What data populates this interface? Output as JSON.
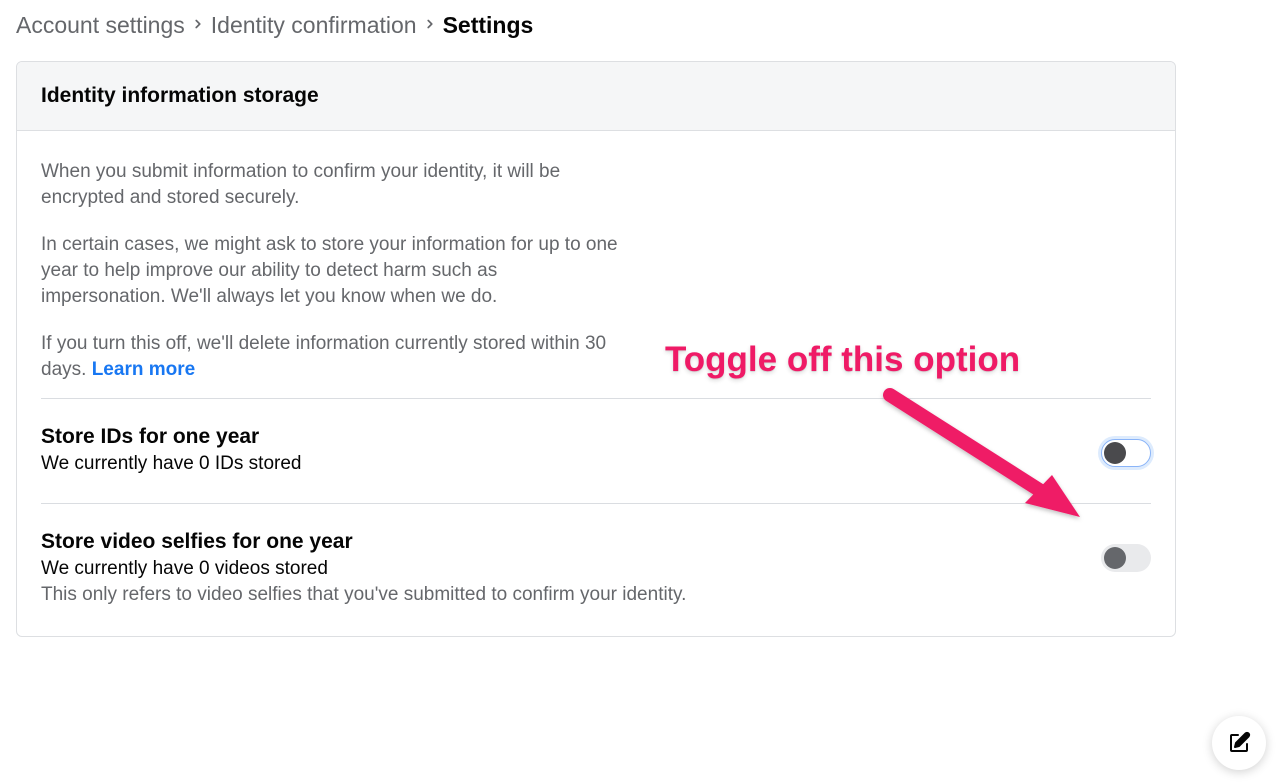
{
  "breadcrumb": {
    "items": [
      {
        "label": "Account settings"
      },
      {
        "label": "Identity confirmation"
      },
      {
        "label": "Settings"
      }
    ]
  },
  "card": {
    "header": "Identity information storage",
    "intro": {
      "p1": "When you submit information to confirm your identity, it will be encrypted and stored securely.",
      "p2": "In certain cases, we might ask to store your information for up to one year to help improve our ability to detect harm such as impersonation. We'll always let you know when we do.",
      "p3_prefix": "If you turn this off, we'll delete information currently stored within 30 days. ",
      "learn_more": "Learn more"
    },
    "sections": {
      "ids": {
        "title": "Store IDs for one year",
        "subtitle": "We currently have 0 IDs stored",
        "toggle_on": false,
        "highlighted": true
      },
      "videos": {
        "title": "Store video selfies for one year",
        "subtitle": "We currently have 0 videos stored",
        "description": "This only refers to video selfies that you've submitted to confirm your identity.",
        "toggle_on": false,
        "highlighted": false
      }
    }
  },
  "annotation": {
    "text": "Toggle off this option"
  },
  "fab": {
    "icon_name": "compose-icon"
  }
}
